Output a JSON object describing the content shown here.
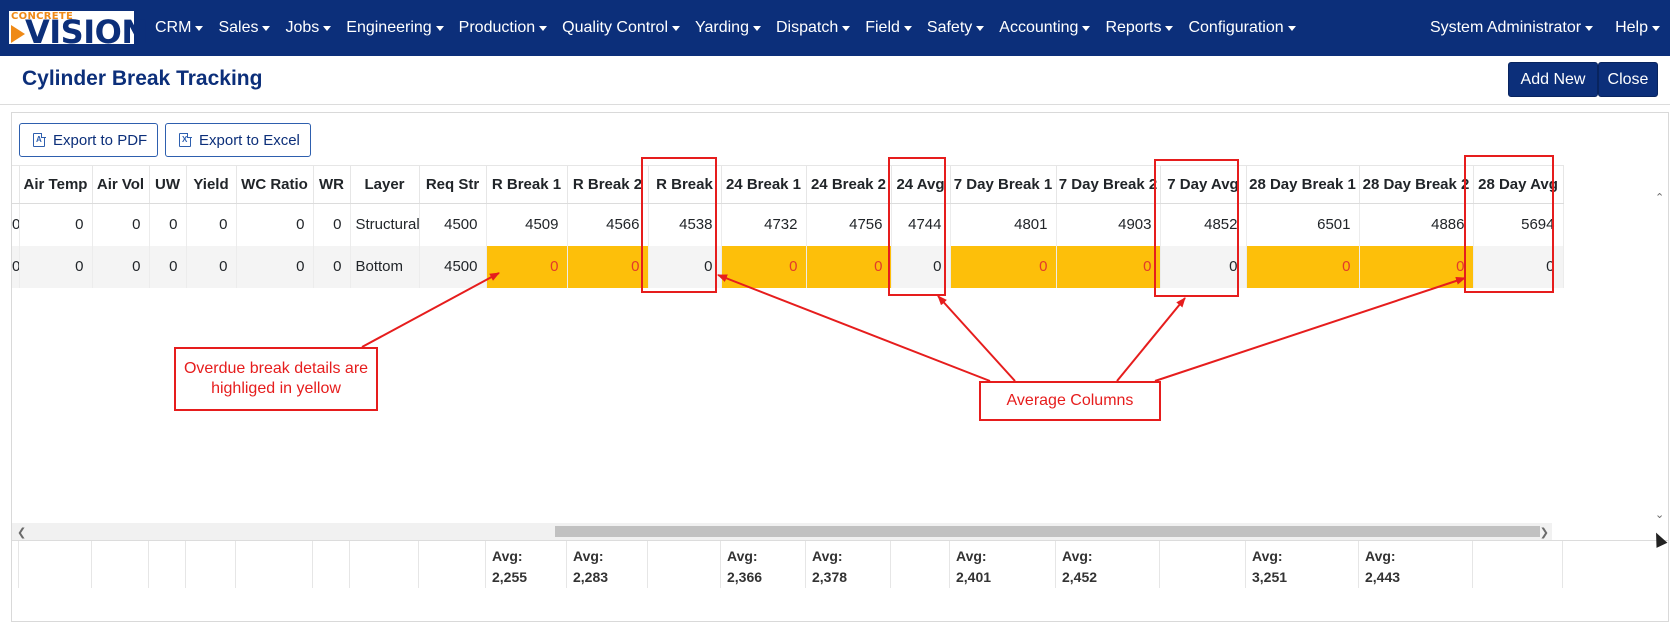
{
  "brand": {
    "logo_small": "CONCRETE",
    "logo_big": "VISION"
  },
  "nav": {
    "items": [
      "CRM",
      "Sales",
      "Jobs",
      "Engineering",
      "Production",
      "Quality Control",
      "Yarding",
      "Dispatch",
      "Field",
      "Safety",
      "Accounting",
      "Reports",
      "Configuration"
    ],
    "user": "System Administrator",
    "help": "Help"
  },
  "page": {
    "title": "Cylinder Break Tracking",
    "add_new": "Add New",
    "close": "Close"
  },
  "toolbar": {
    "export_pdf": "Export to PDF",
    "export_excel": "Export to Excel"
  },
  "grid": {
    "headers": [
      "",
      "Air Temp",
      "Air Vol",
      "UW",
      "Yield",
      "WC Ratio",
      "WR",
      "Layer",
      "Req Str",
      "R Break 1",
      "R Break 2",
      "R Break",
      "24 Break 1",
      "24 Break 2",
      "24 Avg",
      "7 Day Break 1",
      "7 Day Break 2",
      "7 Day Avg",
      "28 Day Break 1",
      "28 Day Break 2",
      "28 Day Avg"
    ],
    "rows": [
      [
        "0",
        "0",
        "0",
        "0",
        "0",
        "0",
        "0",
        "Structural",
        "4500",
        "4509",
        "4566",
        "4538",
        "4732",
        "4756",
        "4744",
        "4801",
        "4903",
        "4852",
        "6501",
        "4886",
        "5694"
      ],
      [
        "0",
        "0",
        "0",
        "0",
        "0",
        "0",
        "0",
        "Bottom",
        "4500",
        "0",
        "0",
        "0",
        "0",
        "0",
        "0",
        "0",
        "0",
        "0",
        "0",
        "0",
        "0"
      ]
    ],
    "overdue_label_color": "#e23b2a",
    "overdue_fill_color": "#fdbf0a",
    "footer": [
      "",
      "",
      "",
      "",
      "",
      "",
      "",
      "",
      "",
      "Avg:\n2,255",
      "Avg:\n2,283",
      "",
      "Avg:\n2,366",
      "Avg:\n2,378",
      "",
      "Avg:\n2,401",
      "Avg:\n2,452",
      "",
      "Avg:\n3,251",
      "Avg:\n2,443",
      ""
    ]
  },
  "annotations": {
    "overdue_note": "Overdue break details are highliged in yellow",
    "average_note": "Average Columns",
    "color": "#e61d1d"
  },
  "theme": {
    "navbar": "#0c2f7a",
    "accent": "#0c2f7a"
  }
}
